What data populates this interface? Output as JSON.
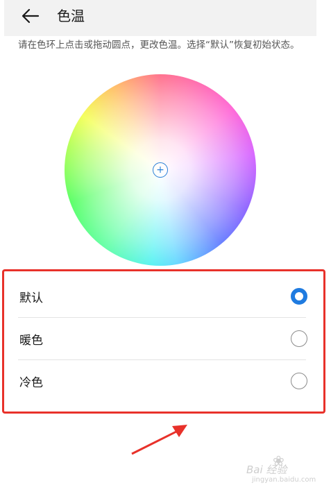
{
  "header": {
    "title": "色温",
    "back_icon": "arrow-left-icon"
  },
  "description": "请在色环上点击或拖动圆点，更改色温。选择“默认”恢复初始状态。",
  "color_wheel": {
    "picker_symbol": "+"
  },
  "options": [
    {
      "label": "默认",
      "selected": true
    },
    {
      "label": "暖色",
      "selected": false
    },
    {
      "label": "冷色",
      "selected": false
    }
  ],
  "colors": {
    "accent": "#1f7be0",
    "highlight_border": "#e8312a",
    "header_bg": "#f2f2f2"
  },
  "watermark": {
    "brand": "Bai 经验",
    "url": "jingyan.baidu.com"
  }
}
